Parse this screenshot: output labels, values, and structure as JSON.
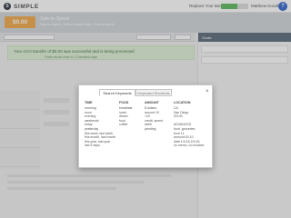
{
  "app": {
    "logo_text": "SIMPLE",
    "logo_mark": "S"
  },
  "topbar": {
    "replace_label": "Replace Your Bank",
    "progress_percent": 60,
    "progress_color": "#5cb85c",
    "user_name": "Matthew Doodle",
    "help_icon": "?"
  },
  "account": {
    "balance": "$0.00",
    "name": "Safe-to-Spend",
    "subtitle": "Safe-to-Spend · Safe-to-Spend Safe · Safe-to-Spend"
  },
  "banner": {
    "title": "Your ACH transfer of $0.00 was successful and is being processed",
    "subtitle": "Funds should arrive in 1-3 business days"
  },
  "right_panel": {
    "title": "Goals"
  },
  "modal": {
    "tabs": [
      "Search Keywords",
      "Keyboard Shortcuts"
    ],
    "active_tab": "Search Keywords",
    "close_icon": "×",
    "columns": [
      {
        "header": "TIME",
        "items": [
          "morning",
          "noon",
          "evening",
          "weekends",
          "today",
          "yesterday",
          "this week, last week",
          "this month, last month",
          "this year, last year",
          "last 5 days"
        ]
      },
      {
        "header": "FOOD",
        "items": [
          "breakfast",
          "lunch",
          "dinner",
          "food",
          "coffee"
        ]
      },
      {
        "header": "AMOUNT",
        "items": [
          "$ dollars",
          "around 15",
          "<20",
          "credit, spend",
          "debit",
          "pending"
        ]
      },
      {
        "header": "LOCATION",
        "items": [
          "CA",
          "San Diego",
          "92130",
          "",
          "ADVANCED",
          "food -groceries",
          "food 11",
          "amount:30-10",
          "date:1/1/15-2/1/15",
          "no memo, no location"
        ]
      }
    ]
  },
  "colors": {
    "accent": "#3366cc",
    "balance": "#f0a94a",
    "banner_bg": "#dff0d8"
  }
}
